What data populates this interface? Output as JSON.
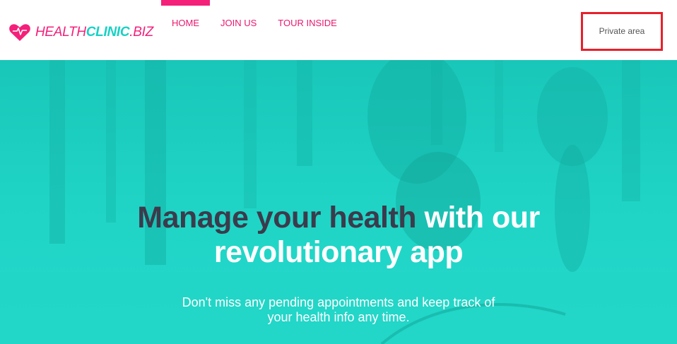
{
  "brand": {
    "health": "HEALTH",
    "clinic": "CLINIC",
    "biz": ".BIZ",
    "colors": {
      "pink": "#f4207a",
      "teal": "#17d1c5"
    }
  },
  "nav": {
    "items": [
      {
        "label": "HOME",
        "active": true
      },
      {
        "label": "JOIN US",
        "active": false
      },
      {
        "label": "TOUR INSIDE",
        "active": false
      }
    ]
  },
  "header": {
    "private_area": "Private area",
    "highlight_color": "#e8202a"
  },
  "hero": {
    "title_dark": "Manage your health",
    "title_light_1": "with our",
    "title_light_2": "revolutionary app",
    "subtitle_line_1": "Don't miss any pending appointments and keep track of",
    "subtitle_line_2": "your health info any time.",
    "background_color": "#1dd3c4",
    "title_dark_color": "#3b3b4c"
  },
  "icons": {
    "logo": "heart-icon"
  }
}
